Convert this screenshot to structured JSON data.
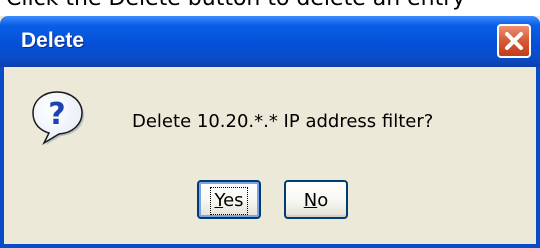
{
  "partial_top_text": "Click the Delete button to delete an entry",
  "dialog": {
    "title": "Delete",
    "close_icon": "close-icon",
    "question_icon": "question-mark-icon",
    "message": "Delete 10.20.*.* IP address filter?",
    "buttons": {
      "yes": {
        "mnemonic": "Y",
        "rest": "es"
      },
      "no": {
        "mnemonic": "N",
        "rest": "o"
      }
    }
  },
  "colors": {
    "titlebar_blue": "#0550d8",
    "dialog_face": "#ece9d8",
    "close_red": "#d75d3a",
    "button_border": "#003c74"
  }
}
